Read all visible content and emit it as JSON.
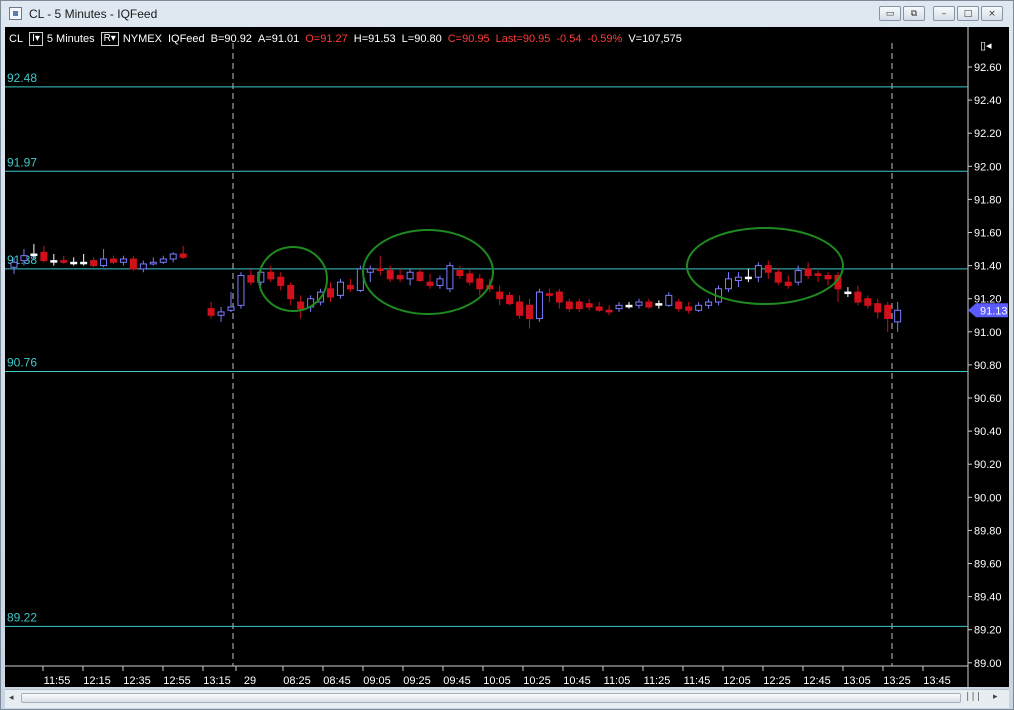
{
  "window": {
    "title": "CL - 5 Minutes - IQFeed",
    "buttons": {
      "restore_label": "▭",
      "link_label": "⧉",
      "minimize_label": "–",
      "maximize_label": "□",
      "close_label": "×"
    }
  },
  "infobar": {
    "symbol": "CL",
    "interval_box": "I▾",
    "interval": "5 Minutes",
    "range_box": "R▾",
    "exchange": "NYMEX",
    "feed": "IQFeed",
    "bid": "B=90.92",
    "ask": "A=91.01",
    "open": "O=91.27",
    "high": "H=91.53",
    "low": "L=90.80",
    "close": "C=90.95",
    "last": "Last=90.95",
    "change": "-0.54",
    "change_pct": "-0.59%",
    "volume": "V=107,575"
  },
  "right_axis_icon_label": "▯◂",
  "colors": {
    "background": "#000000",
    "axis_text": "#ffffff",
    "level_line": "#3ec8c8",
    "up_candle": "#7b7bff",
    "down_candle": "#d0101a",
    "doji": "#ffffff",
    "circle": "#1f8a1f",
    "last_price_tag": "#5a5aff"
  },
  "levels": [
    {
      "value": 92.48,
      "label": "92.48"
    },
    {
      "value": 91.97,
      "label": "91.97"
    },
    {
      "value": 91.38,
      "label": "91.38"
    },
    {
      "value": 90.76,
      "label": "90.76"
    },
    {
      "value": 89.22,
      "label": "89.22"
    }
  ],
  "last_price_label": "91.13",
  "chart_data": {
    "type": "candlestick",
    "y_ticks": [
      "92.60",
      "92.40",
      "92.20",
      "92.00",
      "91.80",
      "91.60",
      "91.40",
      "91.20",
      "91.00",
      "90.80",
      "90.60",
      "90.40",
      "90.20",
      "90.00",
      "89.80",
      "89.60",
      "89.40",
      "89.20",
      "89.00"
    ],
    "ylim": [
      88.95,
      92.7
    ],
    "x_ticks": [
      "11:55",
      "12:15",
      "12:35",
      "12:55",
      "13:15",
      "29",
      "08:25",
      "08:45",
      "09:05",
      "09:25",
      "09:45",
      "10:05",
      "10:25",
      "10:45",
      "11:05",
      "11:25",
      "11:45",
      "12:05",
      "12:25",
      "12:45",
      "13:05",
      "13:25",
      "13:45"
    ],
    "candles": [
      {
        "o": 91.39,
        "h": 91.45,
        "l": 91.35,
        "c": 91.42
      },
      {
        "o": 91.43,
        "h": 91.5,
        "l": 91.4,
        "c": 91.46
      },
      {
        "o": 91.47,
        "h": 91.53,
        "l": 91.44,
        "c": 91.47
      },
      {
        "o": 91.48,
        "h": 91.52,
        "l": 91.42,
        "c": 91.43
      },
      {
        "o": 91.43,
        "h": 91.47,
        "l": 91.4,
        "c": 91.43
      },
      {
        "o": 91.43,
        "h": 91.46,
        "l": 91.41,
        "c": 91.42
      },
      {
        "o": 91.42,
        "h": 91.45,
        "l": 91.4,
        "c": 91.42
      },
      {
        "o": 91.42,
        "h": 91.47,
        "l": 91.4,
        "c": 91.42
      },
      {
        "o": 91.43,
        "h": 91.45,
        "l": 91.39,
        "c": 91.4
      },
      {
        "o": 91.4,
        "h": 91.5,
        "l": 91.39,
        "c": 91.44
      },
      {
        "o": 91.44,
        "h": 91.46,
        "l": 91.41,
        "c": 91.42
      },
      {
        "o": 91.42,
        "h": 91.46,
        "l": 91.4,
        "c": 91.44
      },
      {
        "o": 91.44,
        "h": 91.46,
        "l": 91.37,
        "c": 91.38
      },
      {
        "o": 91.38,
        "h": 91.43,
        "l": 91.36,
        "c": 91.41
      },
      {
        "o": 91.41,
        "h": 91.45,
        "l": 91.4,
        "c": 91.42
      },
      {
        "o": 91.42,
        "h": 91.46,
        "l": 91.41,
        "c": 91.44
      },
      {
        "o": 91.44,
        "h": 91.48,
        "l": 91.42,
        "c": 91.47
      },
      {
        "o": 91.47,
        "h": 91.52,
        "l": 91.44,
        "c": 91.45
      },
      {
        "o": 91.14,
        "h": 91.18,
        "l": 91.08,
        "c": 91.1
      },
      {
        "o": 91.1,
        "h": 91.15,
        "l": 91.06,
        "c": 91.12
      },
      {
        "o": 91.13,
        "h": 91.24,
        "l": 91.12,
        "c": 91.15
      },
      {
        "o": 91.16,
        "h": 91.36,
        "l": 91.14,
        "c": 91.34
      },
      {
        "o": 91.34,
        "h": 91.38,
        "l": 91.28,
        "c": 91.3
      },
      {
        "o": 91.3,
        "h": 91.39,
        "l": 91.28,
        "c": 91.36
      },
      {
        "o": 91.36,
        "h": 91.4,
        "l": 91.3,
        "c": 91.32
      },
      {
        "o": 91.33,
        "h": 91.36,
        "l": 91.25,
        "c": 91.28
      },
      {
        "o": 91.28,
        "h": 91.3,
        "l": 91.16,
        "c": 91.2
      },
      {
        "o": 91.18,
        "h": 91.22,
        "l": 91.08,
        "c": 91.14
      },
      {
        "o": 91.15,
        "h": 91.22,
        "l": 91.12,
        "c": 91.2
      },
      {
        "o": 91.18,
        "h": 91.26,
        "l": 91.16,
        "c": 91.24
      },
      {
        "o": 91.26,
        "h": 91.3,
        "l": 91.18,
        "c": 91.21
      },
      {
        "o": 91.22,
        "h": 91.32,
        "l": 91.2,
        "c": 91.3
      },
      {
        "o": 91.28,
        "h": 91.32,
        "l": 91.24,
        "c": 91.26
      },
      {
        "o": 91.25,
        "h": 91.4,
        "l": 91.24,
        "c": 91.38
      },
      {
        "o": 91.36,
        "h": 91.4,
        "l": 91.3,
        "c": 91.38
      },
      {
        "o": 91.38,
        "h": 91.46,
        "l": 91.34,
        "c": 91.37
      },
      {
        "o": 91.37,
        "h": 91.4,
        "l": 91.3,
        "c": 91.32
      },
      {
        "o": 91.34,
        "h": 91.38,
        "l": 91.3,
        "c": 91.32
      },
      {
        "o": 91.32,
        "h": 91.38,
        "l": 91.28,
        "c": 91.36
      },
      {
        "o": 91.36,
        "h": 91.38,
        "l": 91.3,
        "c": 91.31
      },
      {
        "o": 91.3,
        "h": 91.35,
        "l": 91.26,
        "c": 91.28
      },
      {
        "o": 91.28,
        "h": 91.34,
        "l": 91.26,
        "c": 91.32
      },
      {
        "o": 91.26,
        "h": 91.42,
        "l": 91.24,
        "c": 91.4
      },
      {
        "o": 91.37,
        "h": 91.4,
        "l": 91.32,
        "c": 91.34
      },
      {
        "o": 91.35,
        "h": 91.38,
        "l": 91.28,
        "c": 91.3
      },
      {
        "o": 91.32,
        "h": 91.35,
        "l": 91.22,
        "c": 91.26
      },
      {
        "o": 91.28,
        "h": 91.32,
        "l": 91.24,
        "c": 91.26
      },
      {
        "o": 91.24,
        "h": 91.28,
        "l": 91.16,
        "c": 91.2
      },
      {
        "o": 91.22,
        "h": 91.24,
        "l": 91.16,
        "c": 91.17
      },
      {
        "o": 91.18,
        "h": 91.22,
        "l": 91.08,
        "c": 91.1
      },
      {
        "o": 91.16,
        "h": 91.2,
        "l": 91.02,
        "c": 91.08
      },
      {
        "o": 91.08,
        "h": 91.26,
        "l": 91.06,
        "c": 91.24
      },
      {
        "o": 91.23,
        "h": 91.26,
        "l": 91.18,
        "c": 91.22
      },
      {
        "o": 91.24,
        "h": 91.26,
        "l": 91.14,
        "c": 91.18
      },
      {
        "o": 91.18,
        "h": 91.2,
        "l": 91.12,
        "c": 91.14
      },
      {
        "o": 91.18,
        "h": 91.2,
        "l": 91.12,
        "c": 91.14
      },
      {
        "o": 91.17,
        "h": 91.2,
        "l": 91.13,
        "c": 91.15
      },
      {
        "o": 91.15,
        "h": 91.18,
        "l": 91.12,
        "c": 91.13
      },
      {
        "o": 91.13,
        "h": 91.16,
        "l": 91.1,
        "c": 91.12
      },
      {
        "o": 91.14,
        "h": 91.18,
        "l": 91.12,
        "c": 91.16
      },
      {
        "o": 91.16,
        "h": 91.18,
        "l": 91.14,
        "c": 91.16
      },
      {
        "o": 91.16,
        "h": 91.2,
        "l": 91.14,
        "c": 91.18
      },
      {
        "o": 91.18,
        "h": 91.2,
        "l": 91.14,
        "c": 91.15
      },
      {
        "o": 91.17,
        "h": 91.19,
        "l": 91.14,
        "c": 91.17
      },
      {
        "o": 91.16,
        "h": 91.24,
        "l": 91.15,
        "c": 91.22
      },
      {
        "o": 91.18,
        "h": 91.2,
        "l": 91.12,
        "c": 91.14
      },
      {
        "o": 91.15,
        "h": 91.18,
        "l": 91.11,
        "c": 91.13
      },
      {
        "o": 91.13,
        "h": 91.18,
        "l": 91.12,
        "c": 91.16
      },
      {
        "o": 91.16,
        "h": 91.2,
        "l": 91.14,
        "c": 91.18
      },
      {
        "o": 91.18,
        "h": 91.28,
        "l": 91.16,
        "c": 91.26
      },
      {
        "o": 91.26,
        "h": 91.36,
        "l": 91.24,
        "c": 91.32
      },
      {
        "o": 91.31,
        "h": 91.36,
        "l": 91.27,
        "c": 91.33
      },
      {
        "o": 91.33,
        "h": 91.38,
        "l": 91.3,
        "c": 91.33
      },
      {
        "o": 91.33,
        "h": 91.42,
        "l": 91.3,
        "c": 91.4
      },
      {
        "o": 91.4,
        "h": 91.43,
        "l": 91.32,
        "c": 91.36
      },
      {
        "o": 91.36,
        "h": 91.38,
        "l": 91.28,
        "c": 91.3
      },
      {
        "o": 91.3,
        "h": 91.34,
        "l": 91.26,
        "c": 91.28
      },
      {
        "o": 91.3,
        "h": 91.4,
        "l": 91.28,
        "c": 91.37
      },
      {
        "o": 91.38,
        "h": 91.42,
        "l": 91.32,
        "c": 91.34
      },
      {
        "o": 91.35,
        "h": 91.37,
        "l": 91.3,
        "c": 91.34
      },
      {
        "o": 91.34,
        "h": 91.36,
        "l": 91.28,
        "c": 91.32
      },
      {
        "o": 91.34,
        "h": 91.36,
        "l": 91.18,
        "c": 91.26
      },
      {
        "o": 91.24,
        "h": 91.27,
        "l": 91.21,
        "c": 91.24
      },
      {
        "o": 91.24,
        "h": 91.28,
        "l": 91.16,
        "c": 91.18
      },
      {
        "o": 91.2,
        "h": 91.22,
        "l": 91.14,
        "c": 91.16
      },
      {
        "o": 91.17,
        "h": 91.2,
        "l": 91.08,
        "c": 91.12
      },
      {
        "o": 91.16,
        "h": 91.18,
        "l": 91.0,
        "c": 91.08
      },
      {
        "o": 91.06,
        "h": 91.18,
        "l": 91.0,
        "c": 91.13
      }
    ]
  }
}
